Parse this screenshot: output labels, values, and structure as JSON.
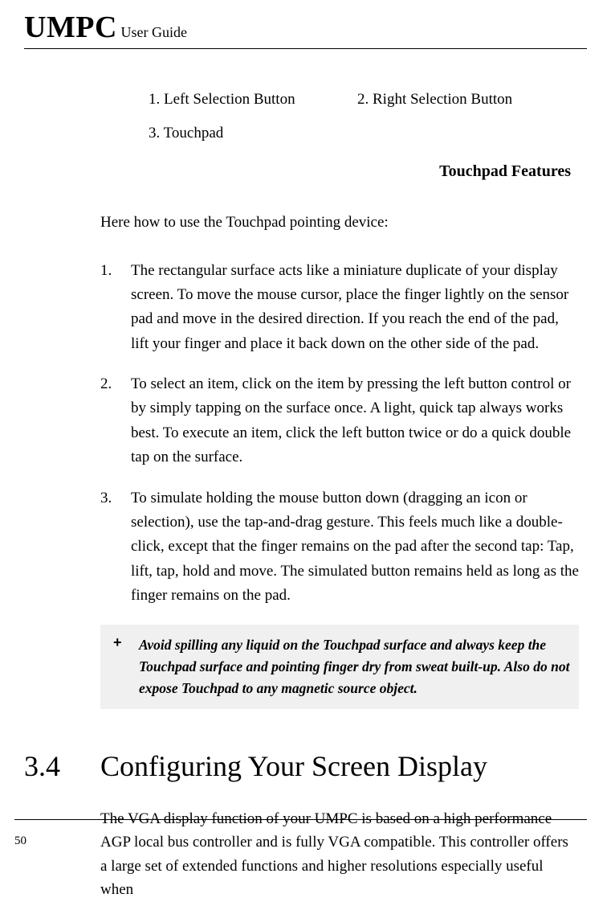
{
  "header": {
    "title_large": "UMPC",
    "title_small": " User Guide"
  },
  "labels": {
    "item1": "1. Left Selection Button",
    "item2": "2. Right Selection Button",
    "item3": "3. Touchpad"
  },
  "section_heading": "Touchpad Features",
  "intro": "Here how to use the Touchpad pointing device:",
  "list": {
    "item1": "The rectangular surface acts like a miniature duplicate of your display screen. To move the mouse cursor, place the finger lightly on the sensor pad and move in the desired direction. If you reach the end of the pad, lift your finger and place it back down on the other side of the pad.",
    "item2": "To select an item, click on the item by pressing the left button control or by simply tapping on the surface once. A light, quick tap always works best. To execute an item, click the left button twice or do a quick double tap on the surface.",
    "item3": "To simulate holding the mouse button down (dragging an icon or selection), use the tap-and-drag gesture. This feels much like a double-click, except that the finger remains on the pad after the second tap: Tap, lift, tap, hold and move. The simulated button remains held as long as the finger remains on the pad."
  },
  "note": {
    "symbol": "+",
    "text": "Avoid spilling any liquid on the Touchpad surface and always keep the Touchpad surface and pointing finger dry from sweat built-up. Also do not expose Touchpad to any magnetic source object."
  },
  "chapter": {
    "num": "3.4",
    "title": "Configuring Your Screen Display"
  },
  "body": "The VGA display function of your UMPC is based on a high performance AGP local bus controller and is fully VGA compatible. This controller offers a large set of extended functions and higher resolutions especially useful when",
  "page_number": "50"
}
